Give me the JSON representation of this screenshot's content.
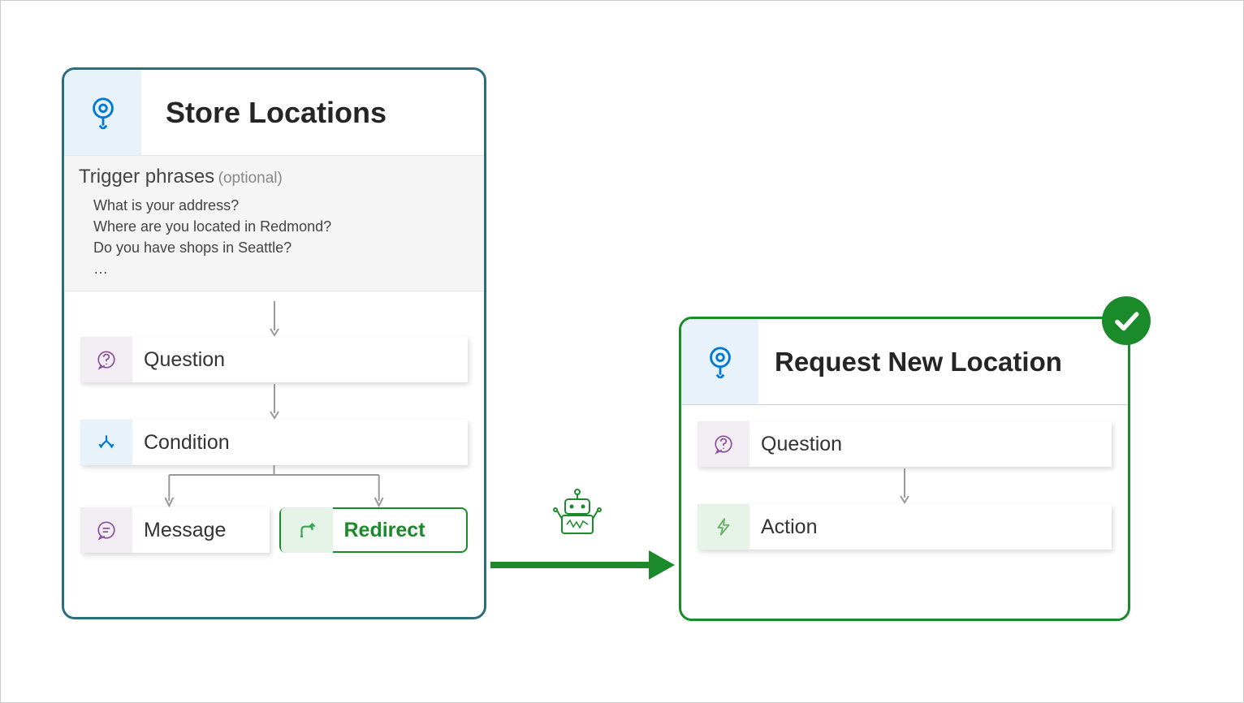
{
  "left_topic": {
    "title": "Store Locations",
    "trigger_label": "Trigger phrases",
    "trigger_optional": "(optional)",
    "phrases": [
      "What is your address?",
      "Where are you located in Redmond?",
      "Do you have shops in Seattle?",
      "…"
    ],
    "nodes": {
      "question": "Question",
      "condition": "Condition",
      "message": "Message",
      "redirect": "Redirect"
    }
  },
  "right_topic": {
    "title": "Request New Location",
    "nodes": {
      "question": "Question",
      "action": "Action"
    }
  }
}
